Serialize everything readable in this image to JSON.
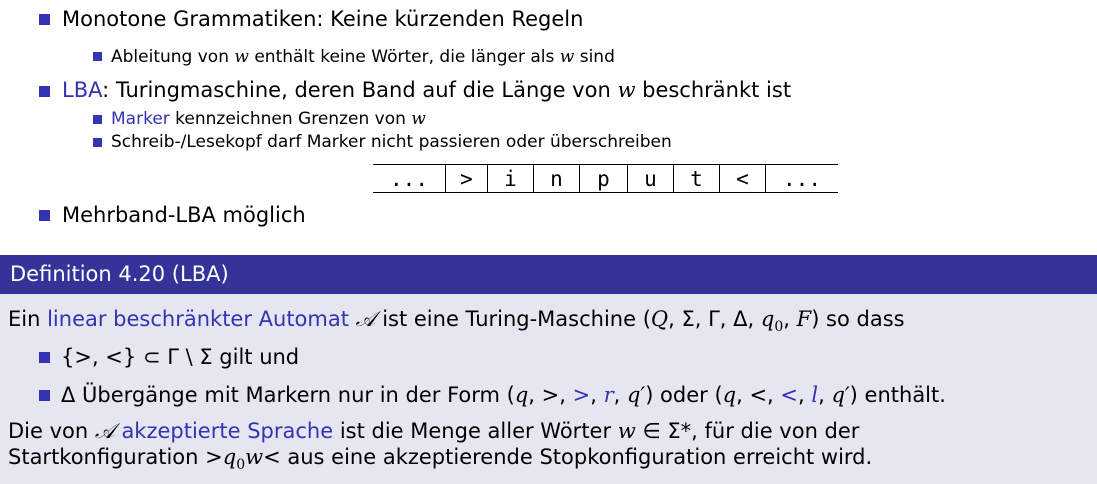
{
  "bullets": {
    "b1": {
      "text": "Monotone Grammatiken: Keine kürzenden Regeln"
    },
    "b1_1": {
      "before": "Ableitung von ",
      "var": "w",
      "mid": " enthält keine Wörter, die länger als ",
      "var2": "w",
      "after": " sind"
    },
    "b2": {
      "link": "LBA",
      "before": ": Turingmaschine, deren Band auf die Länge von ",
      "var": "w",
      "after": " beschränkt ist"
    },
    "b2_1": {
      "link": "Marker",
      "before": " kennzeichnen Grenzen von ",
      "var": "w"
    },
    "b2_2": {
      "text": "Schreib-/Lesekopf darf Marker nicht passieren oder überschreiben"
    },
    "b3": {
      "text": "Mehrband-LBA möglich"
    }
  },
  "tape": [
    "...",
    ">",
    "i",
    "n",
    "p",
    "u",
    "t",
    "<",
    "..."
  ],
  "definition": {
    "title": "Definition 4.20 (LBA)",
    "line1": {
      "before": "Ein ",
      "link": "linear beschränkter Automat",
      "sym": "𝒜",
      "mid": " ist eine Turing-Maschine (",
      "q": "Q",
      "rest": ", Σ, Γ, Δ, ",
      "q0": "q",
      "q0sub": "0",
      "comma": ", ",
      "F": "F",
      "after": ") so dass"
    },
    "item1": {
      "text": "{>, <} ⊂ Γ \\ Σ gilt und"
    },
    "item2": {
      "before": "Δ Übergänge mit Markern nur in der Form (",
      "q": "q",
      "c1": ", >, ",
      "gt": ">",
      "c2": ", ",
      "r": "r",
      "c3": ", ",
      "qp": "q′",
      "mid": ") oder (",
      "q2": "q",
      "c4": ", <, ",
      "lt": "<",
      "c5": ", ",
      "l": "l",
      "c6": ", ",
      "qp2": "q′",
      "after": ") enthält."
    },
    "line2": {
      "before": "Die von ",
      "sym": "𝒜",
      "sp": " ",
      "link": "akzeptierte Sprache",
      "mid": " ist die Menge aller Wörter ",
      "w": "w",
      "after": " ∈ Σ*, für die von der"
    },
    "line3": {
      "before": "Startkonfiguration >",
      "q0": "q",
      "q0sub": "0",
      "w": "w",
      "after": "< aus eine akzeptierende Stopkonfiguration erreicht wird."
    }
  }
}
